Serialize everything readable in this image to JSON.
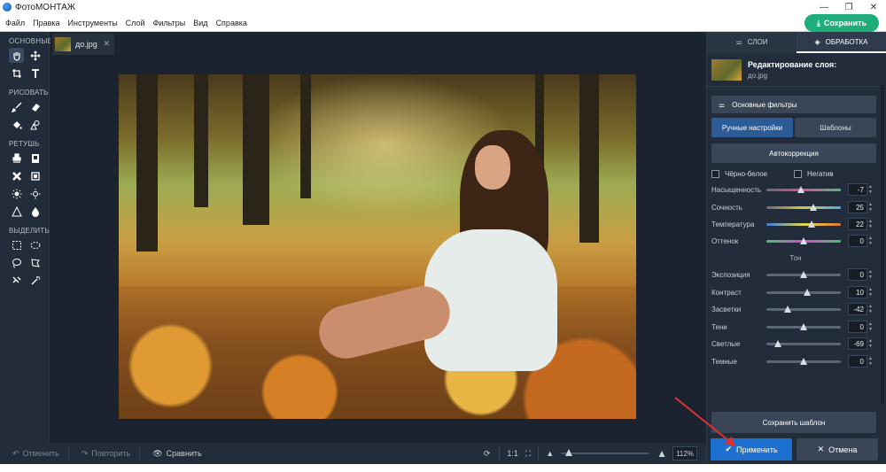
{
  "app": {
    "title": "ФотоМОНТАЖ"
  },
  "menu": {
    "items": [
      "Файл",
      "Правка",
      "Инструменты",
      "Слой",
      "Фильтры",
      "Вид",
      "Справка"
    ]
  },
  "header": {
    "save_label": "Сохранить"
  },
  "toolbar": {
    "groups": [
      "ОСНОВНЫЕ",
      "РИСОВАТЬ",
      "РЕТУШЬ",
      "ВЫДЕЛИТЬ"
    ]
  },
  "document": {
    "tab_name": "до.jpg"
  },
  "bottom_bar": {
    "undo": "Отменить",
    "redo": "Повторить",
    "compare": "Сравнить",
    "ratio": "1:1",
    "zoom": "112%",
    "zoom_fraction": 0.05
  },
  "panel": {
    "tabs": [
      "СЛОИ",
      "ОБРАБОТКА"
    ],
    "layer_title": "Редактирование слоя:",
    "layer_file": "до.jpg",
    "filters_label": "Основные фильтры",
    "sub_tabs": [
      "Ручные настройки",
      "Шаблоны"
    ],
    "autocorrection": "Автокоррекция",
    "bw_label": "Чёрно-белое",
    "negative_label": "Негатив",
    "tone_heading": "Тон",
    "sliders": [
      {
        "label": "Насыщенность",
        "value": "-7",
        "pos": 0.46
      },
      {
        "label": "Сочность",
        "value": "25",
        "pos": 0.63
      },
      {
        "label": "Температура",
        "value": "22",
        "pos": 0.61
      },
      {
        "label": "Оттенок",
        "value": "0",
        "pos": 0.5
      }
    ],
    "tone_sliders": [
      {
        "label": "Экспозиция",
        "value": "0",
        "pos": 0.5
      },
      {
        "label": "Контраст",
        "value": "10",
        "pos": 0.55
      },
      {
        "label": "Засветки",
        "value": "-42",
        "pos": 0.29
      },
      {
        "label": "Тени",
        "value": "0",
        "pos": 0.5
      },
      {
        "label": "Светлые",
        "value": "-69",
        "pos": 0.16
      },
      {
        "label": "Темные",
        "value": "0",
        "pos": 0.5
      }
    ],
    "save_template": "Сохранить шаблон",
    "apply": "Применить",
    "cancel": "Отмена"
  },
  "colors": {
    "accent_green": "#1fae7a",
    "apply_blue": "#1d6fd0",
    "annotation_arrow": "#e03030"
  }
}
